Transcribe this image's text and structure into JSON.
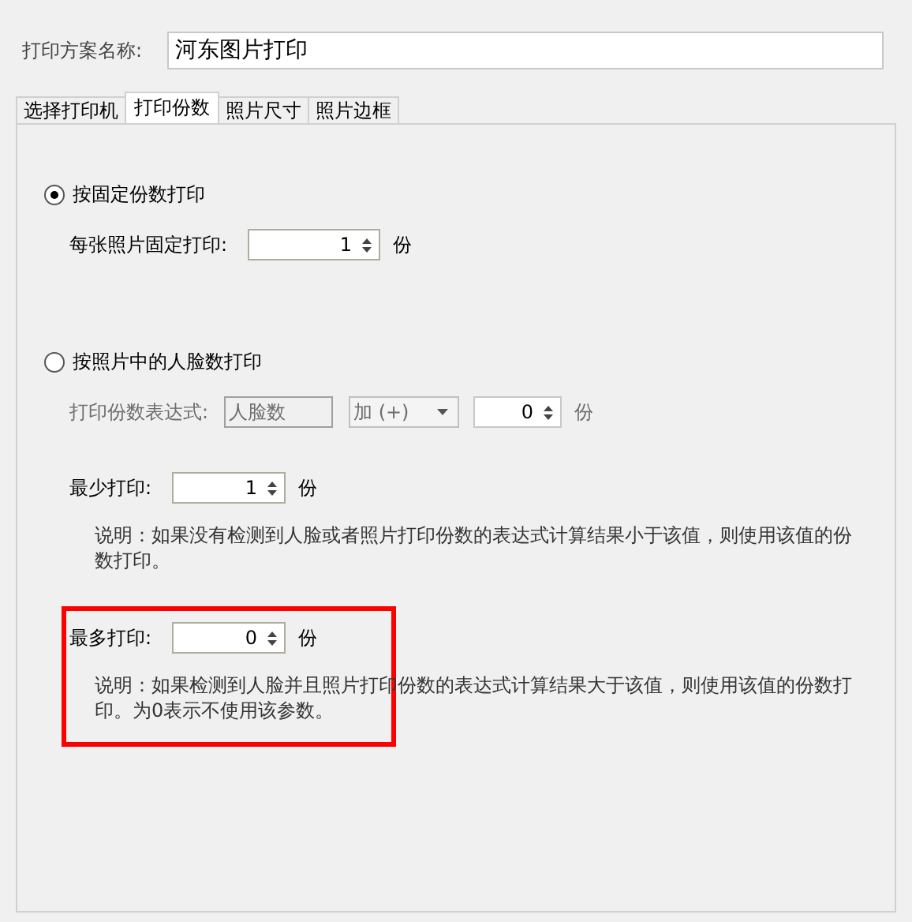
{
  "scheme": {
    "label": "打印方案名称:",
    "value": "河东图片打印"
  },
  "tabs": [
    {
      "label": "选择打印机",
      "selected": false
    },
    {
      "label": "打印份数",
      "selected": true
    },
    {
      "label": "照片尺寸",
      "selected": false
    },
    {
      "label": "照片边框",
      "selected": false
    }
  ],
  "fixed_mode": {
    "label": "按固定份数打印",
    "selected": true,
    "per_photo": {
      "label": "每张照片固定打印:",
      "value": "1",
      "unit": "份"
    }
  },
  "face_mode": {
    "label": "按照片中的人脸数打印",
    "selected": false,
    "expression": {
      "label": "打印份数表达式:",
      "disabled": true,
      "field": "人脸数",
      "operator": "加 (+)",
      "value": "0",
      "unit": "份"
    },
    "min": {
      "label": "最少打印:",
      "value": "1",
      "unit": "份",
      "note": "说明：如果没有检测到人脸或者照片打印份数的表达式计算结果小于该值，则使用该值的份数打印。"
    },
    "max": {
      "label": "最多打印:",
      "value": "0",
      "unit": "份",
      "note": "说明：如果检测到人脸并且照片打印份数的表达式计算结果大于该值，则使用该值的份数打印。为0表示不使用该参数。",
      "highlighted": true
    }
  }
}
